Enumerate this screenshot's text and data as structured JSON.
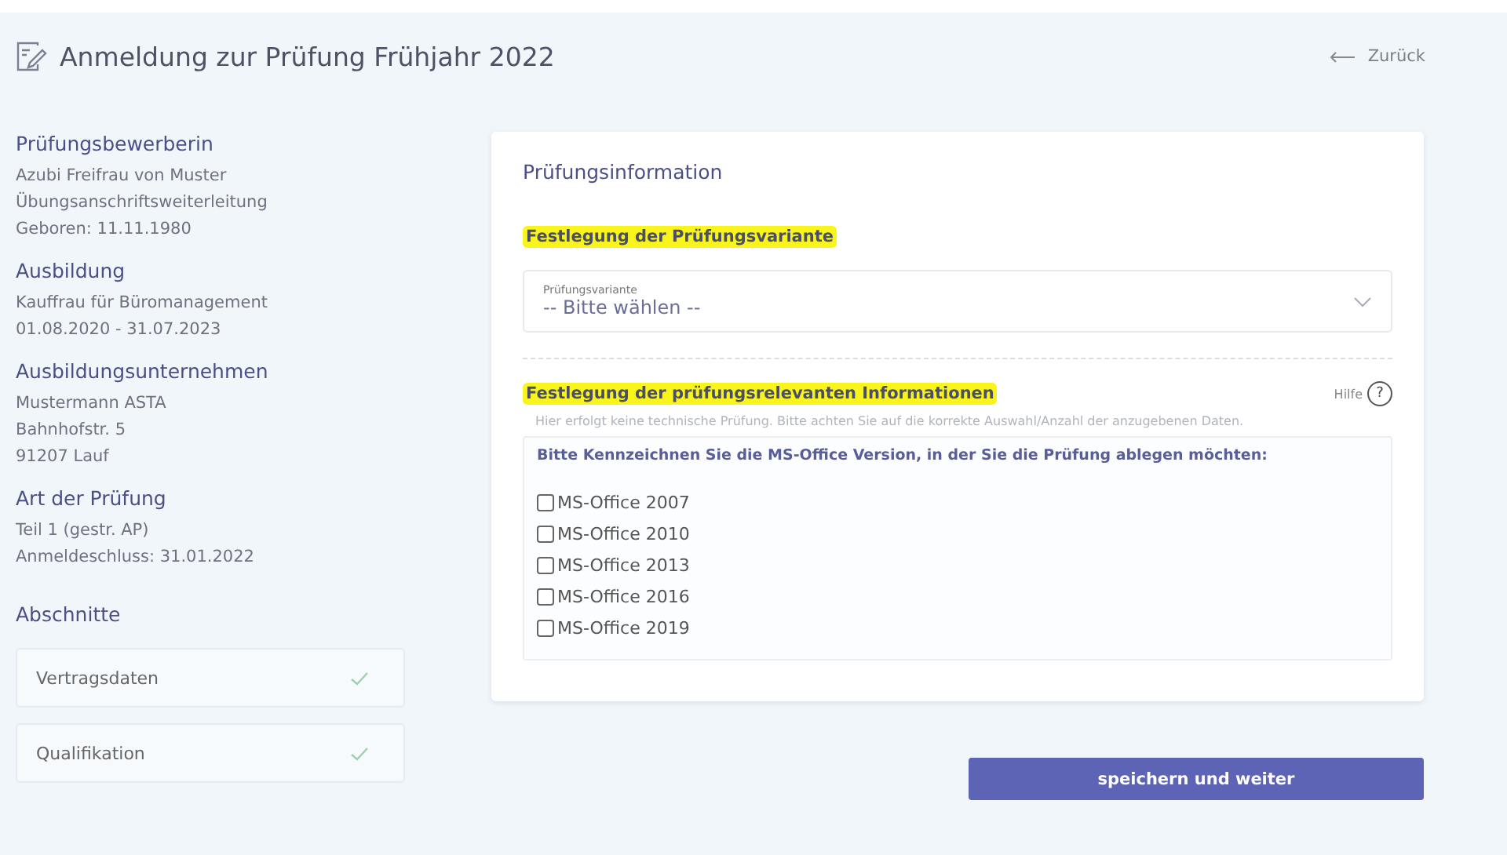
{
  "header": {
    "title": "Anmeldung zur Prüfung Frühjahr 2022",
    "back_link": "Zurück"
  },
  "sidebar": {
    "sections": [
      {
        "heading": "Prüfungsbewerberin",
        "lines": [
          "Azubi Freifrau von Muster",
          "Übungsanschriftsweiterleitung",
          "Geboren: 11.11.1980"
        ]
      },
      {
        "heading": "Ausbildung",
        "lines": [
          "Kauffrau für Büromanagement",
          "01.08.2020 - 31.07.2023"
        ]
      },
      {
        "heading": "Ausbildungsunternehmen",
        "lines": [
          "Mustermann ASTA",
          "Bahnhofstr. 5",
          "91207 Lauf"
        ]
      },
      {
        "heading": "Art der Prüfung",
        "lines": [
          "Teil 1 (gestr. AP)",
          "Anmeldeschluss: 31.01.2022"
        ]
      }
    ],
    "steps_heading": "Abschnitte",
    "steps": [
      {
        "label": "Vertragsdaten",
        "done": true
      },
      {
        "label": "Qualifikation",
        "done": true
      }
    ]
  },
  "card": {
    "title": "Prüfungsinformation",
    "variant_heading": {
      "text": "Festlegung der Prüfungsvariante",
      "highlighted": true
    },
    "variant_select": {
      "label": "Prüfungsvariante",
      "value": "-- Bitte wählen --"
    },
    "info_heading": {
      "text": "Festlegung der prüfungsrelevanten Informationen",
      "highlighted": true
    },
    "help_link": "Hilfe",
    "help_icon": "?",
    "hint": "Hier erfolgt keine technische Prüfung. Bitte achten Sie auf die korrekte Auswahl/Anzahl der anzugebenen Daten.",
    "question": "Bitte Kennzeichnen Sie die MS-Office Version, in der Sie die Prüfung ablegen möchten:",
    "options": [
      {
        "label": "MS-Office 2007",
        "checked": false
      },
      {
        "label": "MS-Office 2010",
        "checked": false
      },
      {
        "label": "MS-Office 2013",
        "checked": false
      },
      {
        "label": "MS-Office 2016",
        "checked": false
      },
      {
        "label": "MS-Office 2019",
        "checked": false
      }
    ]
  },
  "submit_button": "speichern und weiter"
}
